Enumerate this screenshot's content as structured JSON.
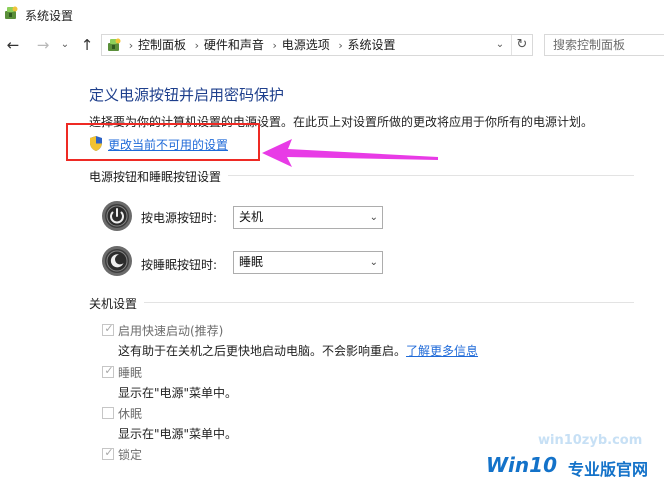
{
  "window": {
    "title": "系统设置",
    "icon": "power-options-icon"
  },
  "nav": {
    "back": "←",
    "forward": "→",
    "recent": "⌄",
    "up": "↑"
  },
  "address": {
    "crumbs": [
      "控制面板",
      "硬件和声音",
      "电源选项",
      "系统设置"
    ],
    "separator": "›",
    "dropdown": "⌄",
    "refresh": "↻"
  },
  "search": {
    "placeholder": "搜索控制面板"
  },
  "main": {
    "heading": "定义电源按钮并启用密码保护",
    "description": "选择要为你的计算机设置的电源设置。在此页上对设置所做的更改将应用于你所有的电源计划。",
    "change_link": "更改当前不可用的设置"
  },
  "power_section": {
    "title": "电源按钮和睡眠按钮设置",
    "rows": [
      {
        "label": "按电源按钮时:",
        "value": "关机",
        "icon": "power-button-icon"
      },
      {
        "label": "按睡眠按钮时:",
        "value": "睡眠",
        "icon": "sleep-button-icon"
      }
    ],
    "select_arrow": "⌄"
  },
  "shutdown_section": {
    "title": "关机设置",
    "check_mark": "✓",
    "fast_startup": {
      "label": "启用快速启动(推荐)",
      "checked": true,
      "desc": "这有助于在关机之后更快地启动电脑。不会影响重启。",
      "learn_more": "了解更多信息"
    },
    "sleep": {
      "label": "睡眠",
      "checked": true,
      "desc": "显示在\"电源\"菜单中。"
    },
    "hibernate": {
      "label": "休眠",
      "checked": false,
      "desc": "显示在\"电源\"菜单中。"
    },
    "lock": {
      "label": "锁定",
      "checked": true
    }
  },
  "watermark": {
    "url": "win10zyb.com",
    "brand_a": "Win10",
    "brand_b": "专业版官网"
  },
  "colors": {
    "heading": "#1e3f8c",
    "link": "#1f6ad8",
    "highlight_box": "#ee2a24",
    "arrow": "#e83be6",
    "watermark": "#1372c9"
  }
}
